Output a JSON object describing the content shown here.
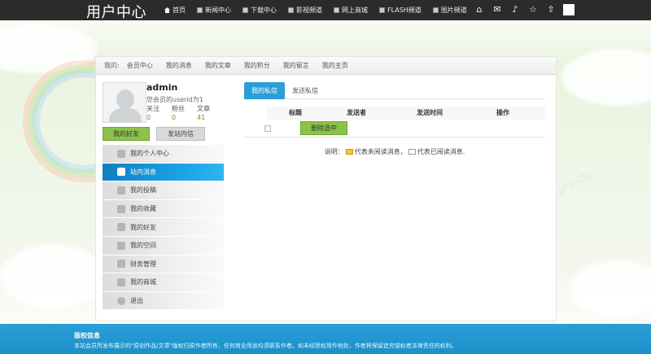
{
  "topbar": {
    "title": "用户中心",
    "nav": [
      {
        "label": "首页",
        "icon": "home-icon"
      },
      {
        "label": "新闻中心",
        "icon": "grid-icon"
      },
      {
        "label": "下载中心",
        "icon": "grid-icon"
      },
      {
        "label": "影视频道",
        "icon": "grid-icon"
      },
      {
        "label": "网上商城",
        "icon": "grid-icon"
      },
      {
        "label": "FLASH频道",
        "icon": "grid-icon"
      },
      {
        "label": "图片频道",
        "icon": "grid-icon"
      }
    ],
    "tools": [
      "home-icon",
      "mail-icon",
      "volume-icon",
      "star-icon",
      "upload-icon",
      "avatar-box"
    ]
  },
  "breadcrumb": {
    "prefix": "我的:",
    "items": [
      "会员中心",
      "我的消息",
      "我的文章",
      "我的积分",
      "我的留言",
      "我的主页"
    ]
  },
  "user": {
    "name": "admin",
    "uid_text": "您会员的userid为1",
    "stats": [
      {
        "label": "关注",
        "value": "0"
      },
      {
        "label": "粉丝",
        "value": "0"
      },
      {
        "label": "文章",
        "value": "41"
      }
    ],
    "friends_button": "我的好友",
    "send_button": "发站内信"
  },
  "menu": [
    {
      "label": "我的个人中心",
      "icon": "user-icon",
      "active": false
    },
    {
      "label": "站内消息",
      "icon": "message-icon",
      "active": true
    },
    {
      "label": "我的投稿",
      "icon": "edit-icon",
      "active": false
    },
    {
      "label": "我的收藏",
      "icon": "bookmark-icon",
      "active": false
    },
    {
      "label": "我的好友",
      "icon": "friends-icon",
      "active": false
    },
    {
      "label": "我的空间",
      "icon": "chat-icon",
      "active": false
    },
    {
      "label": "财务管理",
      "icon": "diamond-icon",
      "active": false
    },
    {
      "label": "我的商城",
      "icon": "cart-icon",
      "active": false
    },
    {
      "label": "退出",
      "icon": "power-icon",
      "active": false
    }
  ],
  "messages": {
    "tabs": [
      "我的私信",
      "发送私信"
    ],
    "columns": [
      "标题",
      "发送者",
      "发送时间",
      "操作"
    ],
    "delete_button": "删除选中",
    "legend_prefix": "说明：",
    "legend_unread": "代表未阅读消息，",
    "legend_read": "代表已阅读消息."
  },
  "footer": {
    "title": "版权信息",
    "text": "本站会员所发布展示的\"原创作品/文章\"版权归原作者所有，任何商业用途均须联系作者。如未经授权用作他处，作者将保留追究侵权者法律责任的权利。"
  },
  "colors": {
    "topbar": "#2b2b2b",
    "accent_blue": "#2a9fd6",
    "accent_green": "#8bc34a",
    "stat_green": "#5aa412"
  }
}
